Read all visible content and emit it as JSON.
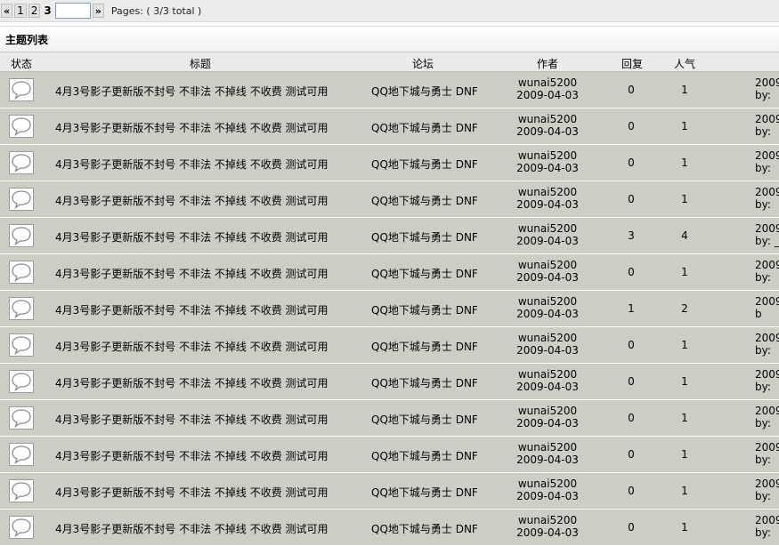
{
  "pager": {
    "prev": "«",
    "pages": [
      "1",
      "2"
    ],
    "current": "3",
    "input_value": "",
    "next": "»",
    "info": "Pages: ( 3/3 total )"
  },
  "section_title": "主题列表",
  "columns": {
    "status": "状态",
    "title": "标题",
    "forum": "论坛",
    "author": "作者",
    "replies": "回复",
    "views": "人气"
  },
  "rows": [
    {
      "title": "4月3号影子更新版不封号 不非法 不掉线 不收费 测试可用",
      "forum": "QQ地下城与勇士 DNF",
      "author": "wunai5200",
      "date": "2009-04-03",
      "replies": "0",
      "views": "1",
      "last_date": "2009",
      "last_by": "by:"
    },
    {
      "title": "4月3号影子更新版不封号 不非法 不掉线 不收费 测试可用",
      "forum": "QQ地下城与勇士 DNF",
      "author": "wunai5200",
      "date": "2009-04-03",
      "replies": "0",
      "views": "1",
      "last_date": "2009",
      "last_by": "by:"
    },
    {
      "title": "4月3号影子更新版不封号 不非法 不掉线 不收费 测试可用",
      "forum": "QQ地下城与勇士 DNF",
      "author": "wunai5200",
      "date": "2009-04-03",
      "replies": "0",
      "views": "1",
      "last_date": "2009",
      "last_by": "by:"
    },
    {
      "title": "4月3号影子更新版不封号 不非法 不掉线 不收费 测试可用",
      "forum": "QQ地下城与勇士 DNF",
      "author": "wunai5200",
      "date": "2009-04-03",
      "replies": "0",
      "views": "1",
      "last_date": "2009",
      "last_by": "by:"
    },
    {
      "title": "4月3号影子更新版不封号 不非法 不掉线 不收费 测试可用",
      "forum": "QQ地下城与勇士 DNF",
      "author": "wunai5200",
      "date": "2009-04-03",
      "replies": "3",
      "views": "4",
      "last_date": "2009",
      "last_by": "by: _"
    },
    {
      "title": "4月3号影子更新版不封号 不非法 不掉线 不收费 测试可用",
      "forum": "QQ地下城与勇士 DNF",
      "author": "wunai5200",
      "date": "2009-04-03",
      "replies": "0",
      "views": "1",
      "last_date": "2009",
      "last_by": "by:"
    },
    {
      "title": "4月3号影子更新版不封号 不非法 不掉线 不收费 测试可用",
      "forum": "QQ地下城与勇士 DNF",
      "author": "wunai5200",
      "date": "2009-04-03",
      "replies": "1",
      "views": "2",
      "last_date": "2009",
      "last_by": "b"
    },
    {
      "title": "4月3号影子更新版不封号 不非法 不掉线 不收费 测试可用",
      "forum": "QQ地下城与勇士 DNF",
      "author": "wunai5200",
      "date": "2009-04-03",
      "replies": "0",
      "views": "1",
      "last_date": "2009",
      "last_by": "by:"
    },
    {
      "title": "4月3号影子更新版不封号 不非法 不掉线 不收费 测试可用",
      "forum": "QQ地下城与勇士 DNF",
      "author": "wunai5200",
      "date": "2009-04-03",
      "replies": "0",
      "views": "1",
      "last_date": "2009",
      "last_by": "by:"
    },
    {
      "title": "4月3号影子更新版不封号 不非法 不掉线 不收费 测试可用",
      "forum": "QQ地下城与勇士 DNF",
      "author": "wunai5200",
      "date": "2009-04-03",
      "replies": "0",
      "views": "1",
      "last_date": "2009",
      "last_by": "by:"
    },
    {
      "title": "4月3号影子更新版不封号 不非法 不掉线 不收费 测试可用",
      "forum": "QQ地下城与勇士 DNF",
      "author": "wunai5200",
      "date": "2009-04-03",
      "replies": "0",
      "views": "1",
      "last_date": "2009",
      "last_by": "by:"
    },
    {
      "title": "4月3号影子更新版不封号 不非法 不掉线 不收费 测试可用",
      "forum": "QQ地下城与勇士 DNF",
      "author": "wunai5200",
      "date": "2009-04-03",
      "replies": "0",
      "views": "1",
      "last_date": "2009",
      "last_by": "by:"
    },
    {
      "title": "4月3号影子更新版不封号 不非法 不掉线 不收费 测试可用",
      "forum": "QQ地下城与勇士 DNF",
      "author": "wunai5200",
      "date": "2009-04-03",
      "replies": "0",
      "views": "1",
      "last_date": "2009",
      "last_by": "by:"
    }
  ],
  "icons": {
    "status": "speech-bubble-icon"
  },
  "colors": {
    "row_bg": "#cdcdc6",
    "header_bg": "#ebebeb",
    "pager_bg": "#ececec"
  }
}
